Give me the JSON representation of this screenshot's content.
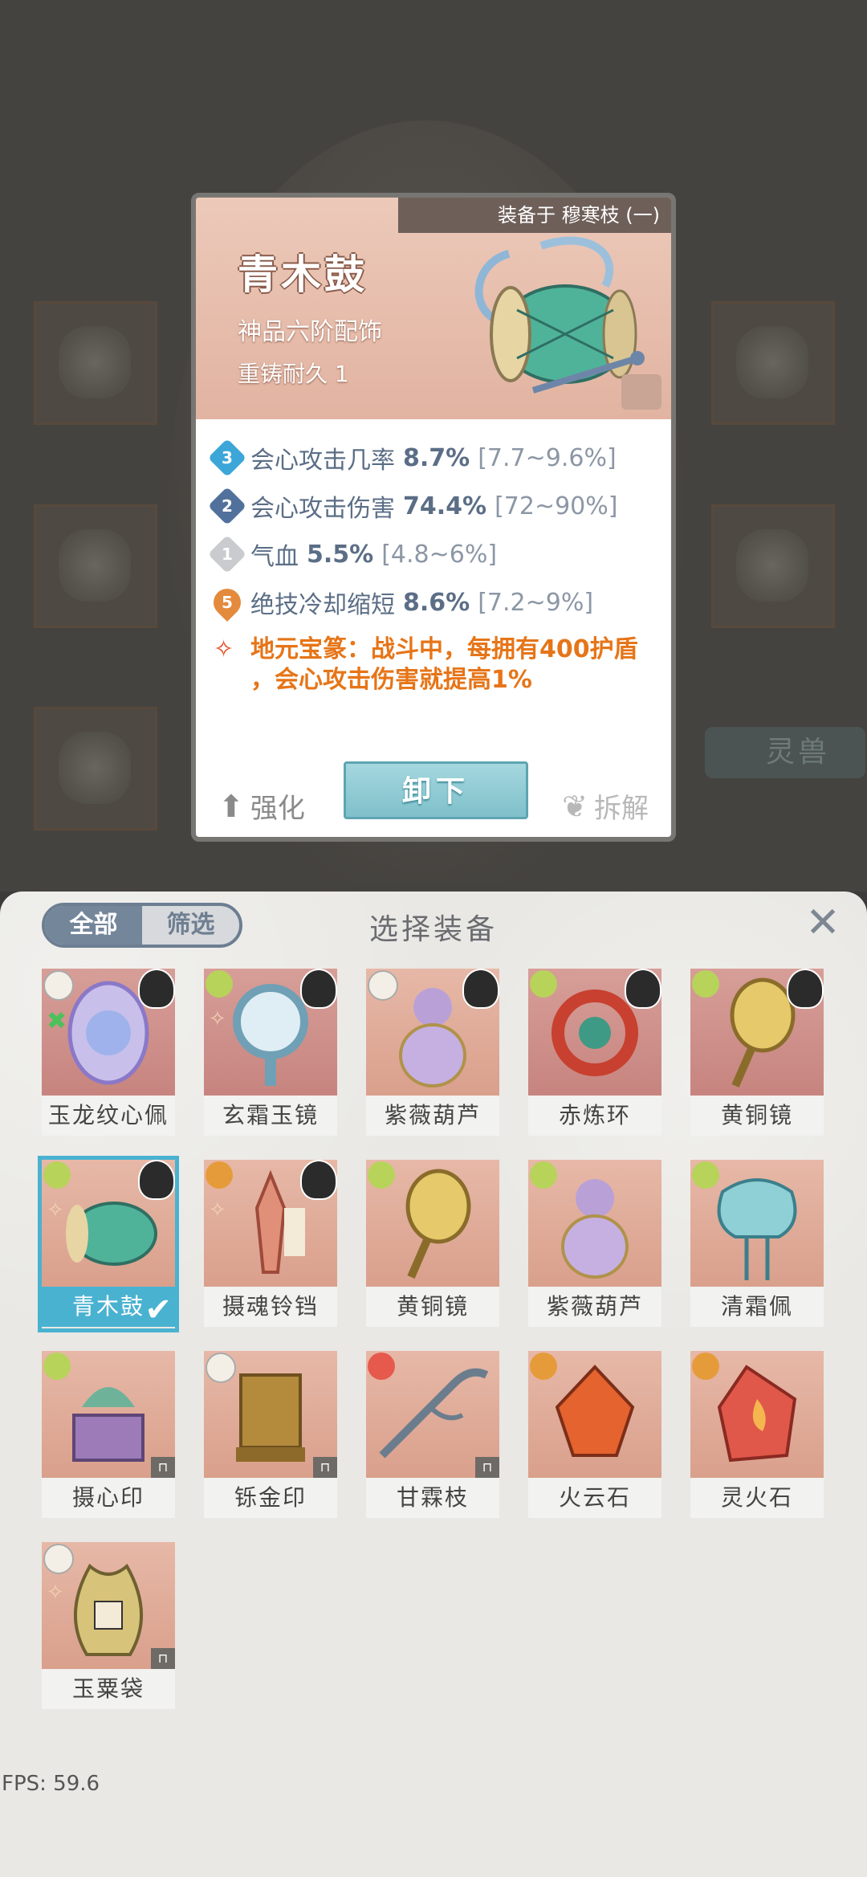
{
  "card": {
    "equipped_on": "装备于 穆寒枝 (一)",
    "name": "青木鼓",
    "grade": "神品六阶配饰",
    "durability": "重铸耐久 1",
    "stats": [
      {
        "rank": "3",
        "name": "会心攻击几率",
        "value": "8.7%",
        "range": "[7.7~9.6%]"
      },
      {
        "rank": "2",
        "name": "会心攻击伤害",
        "value": "74.4%",
        "range": "[72~90%]"
      },
      {
        "rank": "1",
        "name": "气血",
        "value": "5.5%",
        "range": "[4.8~6%]"
      },
      {
        "rank": "5",
        "name": "绝技冷却缩短",
        "value": "8.6%",
        "range": "[7.2~9%]"
      }
    ],
    "skill_line1": "地元宝篆：战斗中，每拥有400护盾",
    "skill_line2": "，会心攻击伤害就提高1%",
    "strengthen_label": "强化",
    "unequip_label": "卸下",
    "dismantle_label": "拆解"
  },
  "background": {
    "beast_button_label": "灵兽"
  },
  "panel": {
    "tab_all": "全部",
    "tab_filter": "筛选",
    "title": "选择装备",
    "close_icon": "✕"
  },
  "items": [
    {
      "label": "玉龙纹心佩"
    },
    {
      "label": "玄霜玉镜"
    },
    {
      "label": "紫薇葫芦"
    },
    {
      "label": "赤炼环"
    },
    {
      "label": "黄铜镜"
    },
    {
      "label": "青木鼓"
    },
    {
      "label": "摄魂铃铛"
    },
    {
      "label": "黄铜镜"
    },
    {
      "label": "紫薇葫芦"
    },
    {
      "label": "清霜佩"
    },
    {
      "label": "摄心印"
    },
    {
      "label": "铄金印"
    },
    {
      "label": "甘霖枝"
    },
    {
      "label": "火云石"
    },
    {
      "label": "灵火石"
    },
    {
      "label": "玉粟袋"
    }
  ],
  "fps": "FPS: 59.6"
}
